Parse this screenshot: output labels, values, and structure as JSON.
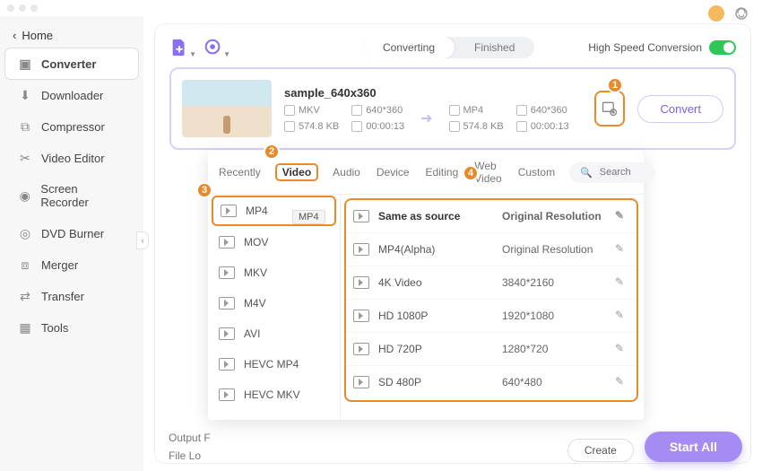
{
  "window": {
    "home": "Home"
  },
  "sidebar": {
    "items": [
      {
        "label": "Converter",
        "icon": "converter-icon"
      },
      {
        "label": "Downloader",
        "icon": "downloader-icon"
      },
      {
        "label": "Compressor",
        "icon": "compressor-icon"
      },
      {
        "label": "Video Editor",
        "icon": "editor-icon"
      },
      {
        "label": "Screen Recorder",
        "icon": "recorder-icon"
      },
      {
        "label": "DVD Burner",
        "icon": "dvd-icon"
      },
      {
        "label": "Merger",
        "icon": "merger-icon"
      },
      {
        "label": "Transfer",
        "icon": "transfer-icon"
      },
      {
        "label": "Tools",
        "icon": "tools-icon"
      }
    ],
    "active_index": 0
  },
  "toolbar": {
    "segments": {
      "converting": "Converting",
      "finished": "Finished",
      "active": "converting"
    },
    "hsc_label": "High Speed Conversion",
    "hsc_on": true
  },
  "file": {
    "name": "sample_640x360",
    "src": {
      "container": "MKV",
      "res": "640*360",
      "size": "574.8 KB",
      "dur": "00:00:13"
    },
    "dst": {
      "container": "MP4",
      "res": "640*360",
      "size": "574.8 KB",
      "dur": "00:00:13"
    },
    "convert_label": "Convert"
  },
  "badges": {
    "b1": "1",
    "b2": "2",
    "b3": "3",
    "b4": "4"
  },
  "dropdown": {
    "tabs": [
      "Recently",
      "Video",
      "Audio",
      "Device",
      "Editing",
      "Web Video",
      "Custom"
    ],
    "tabs_active_index": 1,
    "search_placeholder": "Search",
    "formats": [
      "MP4",
      "MOV",
      "MKV",
      "M4V",
      "AVI",
      "HEVC MP4",
      "HEVC MKV"
    ],
    "formats_active_index": 0,
    "tooltip": "MP4",
    "resolutions": [
      {
        "name": "Same as source",
        "value": "Original Resolution"
      },
      {
        "name": "MP4(Alpha)",
        "value": "Original Resolution"
      },
      {
        "name": "4K Video",
        "value": "3840*2160"
      },
      {
        "name": "HD 1080P",
        "value": "1920*1080"
      },
      {
        "name": "HD 720P",
        "value": "1280*720"
      },
      {
        "name": "SD 480P",
        "value": "640*480"
      }
    ]
  },
  "footer": {
    "output_label": "Output F",
    "file_label": "File Lo",
    "create_label": "Create",
    "startall_label": "Start All"
  },
  "colors": {
    "accent_purple": "#8a6ff1",
    "accent_orange": "#e88a2a",
    "toggle_green": "#2fc75a"
  }
}
